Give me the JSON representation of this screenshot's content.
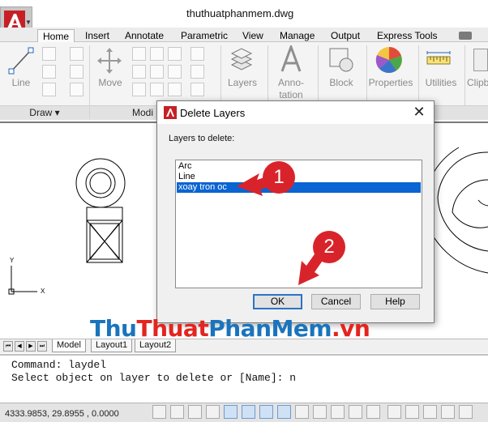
{
  "window": {
    "title": "thuthuatphanmem.dwg"
  },
  "ribbon": {
    "tabs": [
      "Home",
      "Insert",
      "Annotate",
      "Parametric",
      "View",
      "Manage",
      "Output",
      "Express Tools"
    ],
    "active_tab": "Home",
    "tools": {
      "line": "Line",
      "move": "Move",
      "layers": "Layers",
      "annotation": "Anno-\ntation",
      "block": "Block",
      "properties": "Properties",
      "utilities": "Utilities",
      "clipboard": "Clipb"
    },
    "panels": {
      "draw": "Draw",
      "modify": "Modi"
    }
  },
  "dialog": {
    "title": "Delete Layers",
    "prompt": "Layers to delete:",
    "layers": [
      "Arc",
      "Line",
      "xoay tron oc"
    ],
    "selected_index": 2,
    "buttons": {
      "ok": "OK",
      "cancel": "Cancel",
      "help": "Help"
    }
  },
  "layout_tabs": [
    "Model",
    "Layout1",
    "Layout2"
  ],
  "command_line": [
    "Command: laydel",
    "Select object on layer to delete or [Name]: n"
  ],
  "status_bar": {
    "coords": "4333.9853, 29.8955 , 0.0000"
  },
  "ucs": {
    "x_label": "X",
    "y_label": "Y"
  },
  "annotations": {
    "step1": "1",
    "step2": "2",
    "accent_color": "#d9232a"
  },
  "watermark": {
    "part1": "Thu",
    "part2": "Thuat",
    "part3": "PhanMem",
    "part4": ".vn"
  }
}
